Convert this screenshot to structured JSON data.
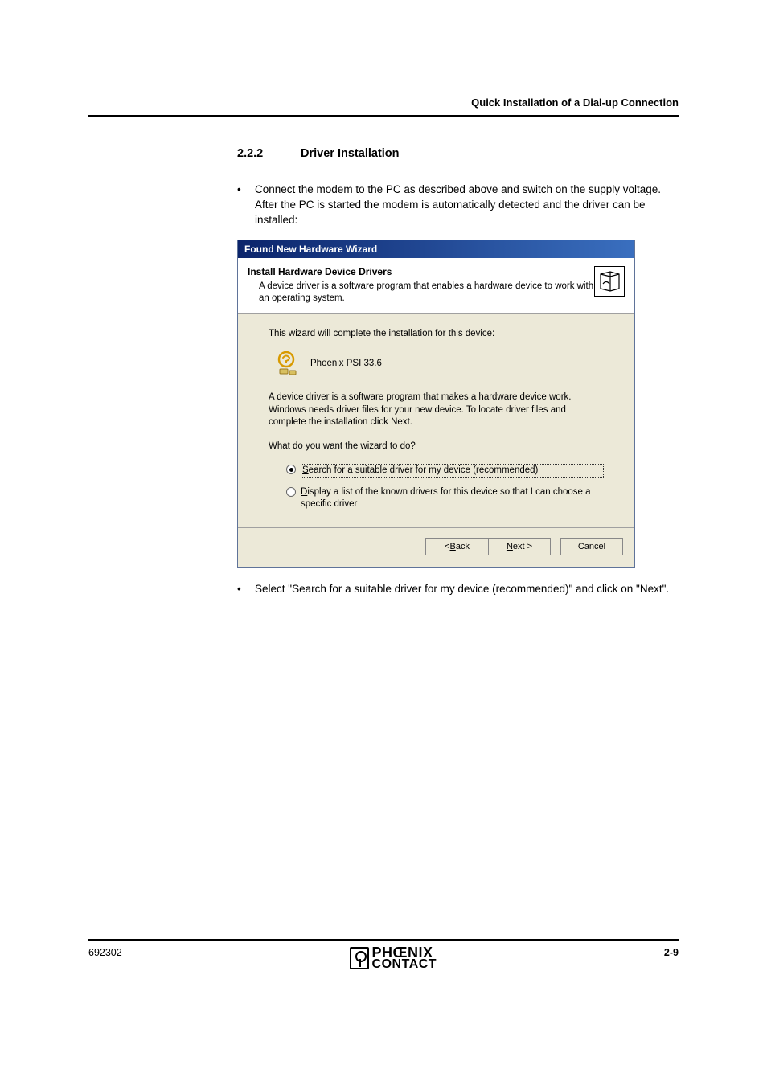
{
  "header": {
    "title": "Quick Installation of a Dial-up Connection"
  },
  "section": {
    "number": "2.2.2",
    "title": "Driver Installation",
    "bullet1": "Connect the modem to the PC as described above and switch on the supply voltage. After the PC is started the modem is automatically detected and the driver can be installed:",
    "bullet2": "Select \"Search for a suitable driver for my device (recommended)\" and click on \"Next\"."
  },
  "wizard": {
    "title": "Found New Hardware Wizard",
    "header_title": "Install Hardware Device Drivers",
    "header_sub": "A device driver is a software program that enables a hardware device to work with an operating system.",
    "body_line1": "This wizard will complete the installation for this device:",
    "device_name": "Phoenix PSI 33.6",
    "body_para": "A device driver is a software program that makes a hardware device work. Windows needs driver files for your new device. To locate driver files and complete the installation click Next.",
    "body_question": "What do you want the wizard to do?",
    "radio1_s": "S",
    "radio1_rest": "earch for a suitable driver for my device (recommended)",
    "radio2_d": "D",
    "radio2_rest": "isplay a list of the known drivers for this device so that I can choose a specific driver",
    "btn_back_lt": "< ",
    "btn_back_b": "B",
    "btn_back_rest": "ack",
    "btn_next_n": "N",
    "btn_next_rest": "ext >",
    "btn_cancel": "Cancel"
  },
  "footer": {
    "left": "692302",
    "logo_line1": "PHŒNIX",
    "logo_line2": "CONTACT",
    "right": "2-9"
  }
}
